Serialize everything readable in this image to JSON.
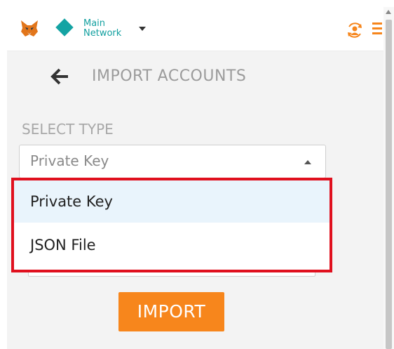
{
  "network": {
    "line1": "Main",
    "line2": "Network"
  },
  "page": {
    "title": "IMPORT ACCOUNTS"
  },
  "form": {
    "select_label": "SELECT TYPE",
    "selected_value": "Private Key",
    "options": [
      "Private Key",
      "JSON File"
    ],
    "highlighted_option_index": 0,
    "import_label": "IMPORT"
  },
  "colors": {
    "accent_orange": "#f6851b",
    "network_teal": "#14a3a3",
    "highlight_red": "#e0101e",
    "option_highlight": "#e9f4fc"
  },
  "icons": [
    "metamask-fox-icon",
    "network-diamond-icon",
    "dropdown-caret-icon",
    "account-switch-icon",
    "hamburger-menu-icon",
    "back-arrow-icon",
    "select-arrow-icon",
    "scroll-up-icon"
  ]
}
